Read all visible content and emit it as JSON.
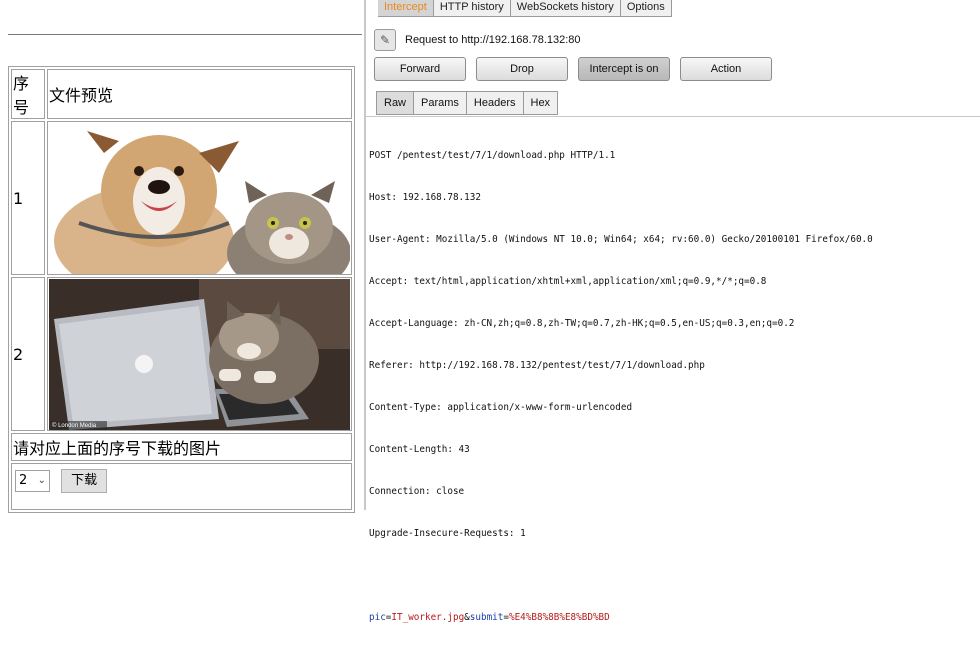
{
  "left_page": {
    "table": {
      "header_num": "序号",
      "header_preview": "文件预览",
      "rows": [
        {
          "num": "1",
          "image": "dog-and-cat photo"
        },
        {
          "num": "2",
          "image": "cat with laptop photo",
          "caption": "© London Media"
        }
      ],
      "instruction": "请对应上面的序号下载的图片",
      "select_value": "2",
      "download_label": "下载"
    }
  },
  "burp": {
    "tabs": [
      "Intercept",
      "HTTP history",
      "WebSockets history",
      "Options"
    ],
    "active_tab": "Intercept",
    "request_to": "Request to http://192.168.78.132:80",
    "buttons": {
      "forward": "Forward",
      "drop": "Drop",
      "intercept": "Intercept is on",
      "action": "Action"
    },
    "subtabs": [
      "Raw",
      "Params",
      "Headers",
      "Hex"
    ],
    "active_subtab": "Raw",
    "raw_lines": [
      "POST /pentest/test/7/1/download.php HTTP/1.1",
      "Host: 192.168.78.132",
      "User-Agent: Mozilla/5.0 (Windows NT 10.0; Win64; x64; rv:60.0) Gecko/20100101 Firefox/60.0",
      "Accept: text/html,application/xhtml+xml,application/xml;q=0.9,*/*;q=0.8",
      "Accept-Language: zh-CN,zh;q=0.8,zh-TW;q=0.7,zh-HK;q=0.5,en-US;q=0.3,en;q=0.2",
      "Referer: http://192.168.78.132/pentest/test/7/1/download.php",
      "Content-Type: application/x-www-form-urlencoded",
      "Content-Length: 43",
      "Connection: close",
      "Upgrade-Insecure-Requests: 1"
    ],
    "body_params": {
      "p1_name": "pic",
      "p1_value": "IT_worker.jpg",
      "p2_name": "submit",
      "p2_value": "%E4%B8%8B%E8%BD%BD"
    },
    "colors": {
      "active_tab_text": "#e68a1d",
      "param_name": "#1f3ea8",
      "param_value": "#b7191b"
    }
  }
}
